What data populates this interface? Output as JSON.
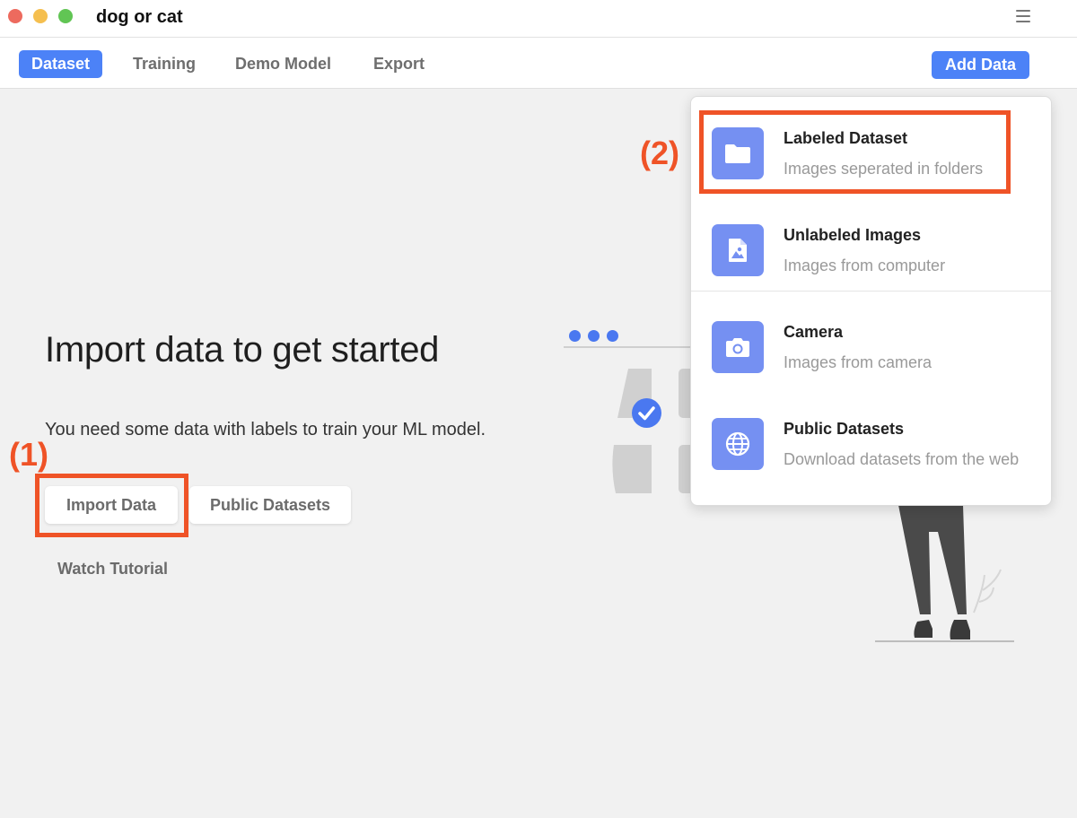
{
  "window": {
    "title": "dog or cat"
  },
  "toolbar": {
    "tabs": [
      {
        "label": "Dataset",
        "active": true
      },
      {
        "label": "Training",
        "active": false
      },
      {
        "label": "Demo Model",
        "active": false
      },
      {
        "label": "Export",
        "active": false
      }
    ],
    "add_data_label": "Add Data"
  },
  "main": {
    "headline": "Import data to get started",
    "subline": "You need some data with labels to train your ML model.",
    "import_button": "Import Data",
    "public_button": "Public Datasets",
    "tutorial_link": "Watch Tutorial"
  },
  "annotations": {
    "step1": "(1)",
    "step2": "(2)",
    "color": "#ef5327"
  },
  "dropdown": {
    "items": [
      {
        "title": "Labeled Dataset",
        "subtitle": "Images seperated in folders",
        "icon": "folder-icon"
      },
      {
        "title": "Unlabeled Images",
        "subtitle": "Images from computer",
        "icon": "image-file-icon"
      },
      {
        "title": "Camera",
        "subtitle": "Images from camera",
        "icon": "camera-icon"
      },
      {
        "title": "Public Datasets",
        "subtitle": "Download datasets from the web",
        "icon": "globe-icon"
      }
    ]
  },
  "colors": {
    "accent": "#4c82f7",
    "icon_bg": "#7590f2"
  }
}
